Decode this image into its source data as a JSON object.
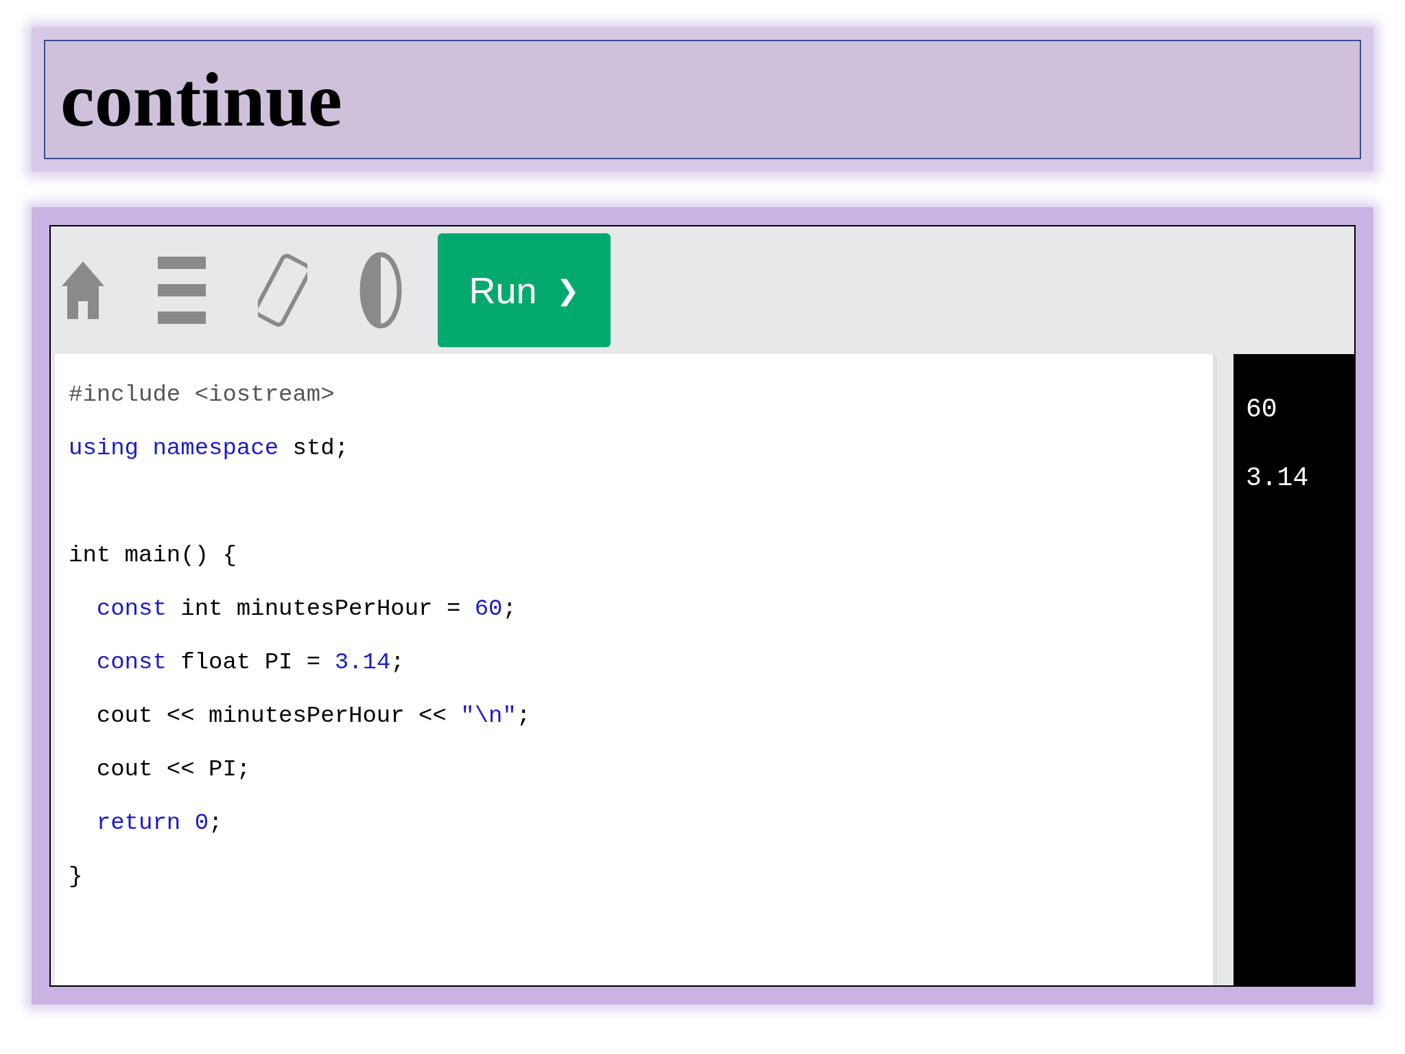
{
  "slide_title": "continue",
  "toolbar": {
    "run_button": {
      "label": "Run",
      "icon": "❯"
    }
  },
  "code_lines": [
    {
      "kind": "code",
      "tokens": [
        {
          "kind": "preprocessor",
          "text": "#include <iostream>"
        }
      ]
    },
    {
      "kind": "code",
      "tokens": [
        {
          "kind": "keyword",
          "text": "using"
        },
        {
          "kind": "keyword",
          "text": " namespace"
        },
        {
          "kind": "plain",
          "text": " std;"
        }
      ]
    },
    {
      "kind": "blank"
    },
    {
      "kind": "code",
      "tokens": [
        {
          "kind": "plain",
          "text": "int main() {"
        }
      ]
    },
    {
      "kind": "code",
      "tokens": [
        {
          "kind": "keyword",
          "text": "  const"
        },
        {
          "kind": "plain",
          "text": " int minutesPerHour = "
        },
        {
          "kind": "number",
          "text": "60"
        },
        {
          "kind": "plain",
          "text": ";"
        }
      ]
    },
    {
      "kind": "code",
      "tokens": [
        {
          "kind": "keyword",
          "text": "  const"
        },
        {
          "kind": "plain",
          "text": " float PI = "
        },
        {
          "kind": "number",
          "text": "3.14"
        },
        {
          "kind": "plain",
          "text": ";"
        }
      ]
    },
    {
      "kind": "code",
      "tokens": [
        {
          "kind": "plain",
          "text": "  cout << minutesPerHour << "
        },
        {
          "kind": "string",
          "text": "\"\\n\""
        },
        {
          "kind": "plain",
          "text": ";"
        }
      ]
    },
    {
      "kind": "code",
      "tokens": [
        {
          "kind": "plain",
          "text": "  cout << PI;"
        }
      ]
    },
    {
      "kind": "code",
      "tokens": [
        {
          "kind": "keyword",
          "text": "  return"
        },
        {
          "kind": "number",
          "text": " 0"
        },
        {
          "kind": "plain",
          "text": ";"
        }
      ]
    },
    {
      "kind": "code",
      "tokens": [
        {
          "kind": "plain",
          "text": "}"
        }
      ]
    }
  ],
  "output_lines": [
    "60",
    "3.14"
  ]
}
